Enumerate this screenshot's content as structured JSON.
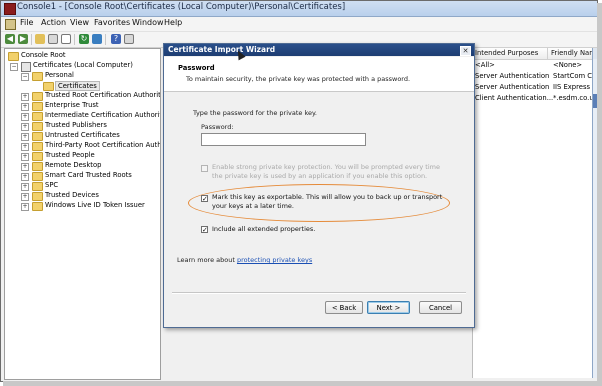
{
  "window": {
    "title": "Console1 - [Console Root\\Certificates (Local Computer)\\Personal\\Certificates]"
  },
  "menu": [
    "File",
    "Action",
    "View",
    "Favorites",
    "Window",
    "Help"
  ],
  "tree": {
    "root": "Console Root",
    "certificates": "Certificates (Local Computer)",
    "personal": "Personal",
    "selected": "Certificates",
    "stores": [
      "Trusted Root Certification Authorities",
      "Enterprise Trust",
      "Intermediate Certification Authorities",
      "Trusted Publishers",
      "Untrusted Certificates",
      "Third-Party Root Certification Authorities",
      "Trusted People",
      "Remote Desktop",
      "Smart Card Trusted Roots",
      "SPC",
      "Trusted Devices",
      "Windows Live ID Token Issuer"
    ]
  },
  "list": {
    "columns": [
      "Intended Purposes",
      "Friendly Nam"
    ],
    "rows": [
      [
        "<All>",
        "<None>"
      ],
      [
        "Server Authentication",
        "StartCom Ce"
      ],
      [
        "Server Authentication",
        "IIS Express I"
      ],
      [
        "Client Authentication...",
        "*.esdm.co.u"
      ]
    ],
    "actions_header": "Ac"
  },
  "dialog": {
    "title": "Certificate Import Wizard",
    "heading": "Password",
    "subheading": "To maintain security, the private key was protected with a password.",
    "instruction": "Type the password for the private key.",
    "password_label": "Password:",
    "password_value": "",
    "strong_protection": "Enable strong private key protection. You will be prompted every time the private key is used by an application if you enable this option.",
    "exportable": "Mark this key as exportable. This will allow you to back up or transport your keys at a later time.",
    "extended": "Include all extended properties.",
    "learn_more": "Learn more about",
    "learn_more_link": "protecting private keys",
    "back": "< Back",
    "next": "Next >",
    "cancel": "Cancel",
    "exportable_checked": true,
    "extended_checked": true
  }
}
